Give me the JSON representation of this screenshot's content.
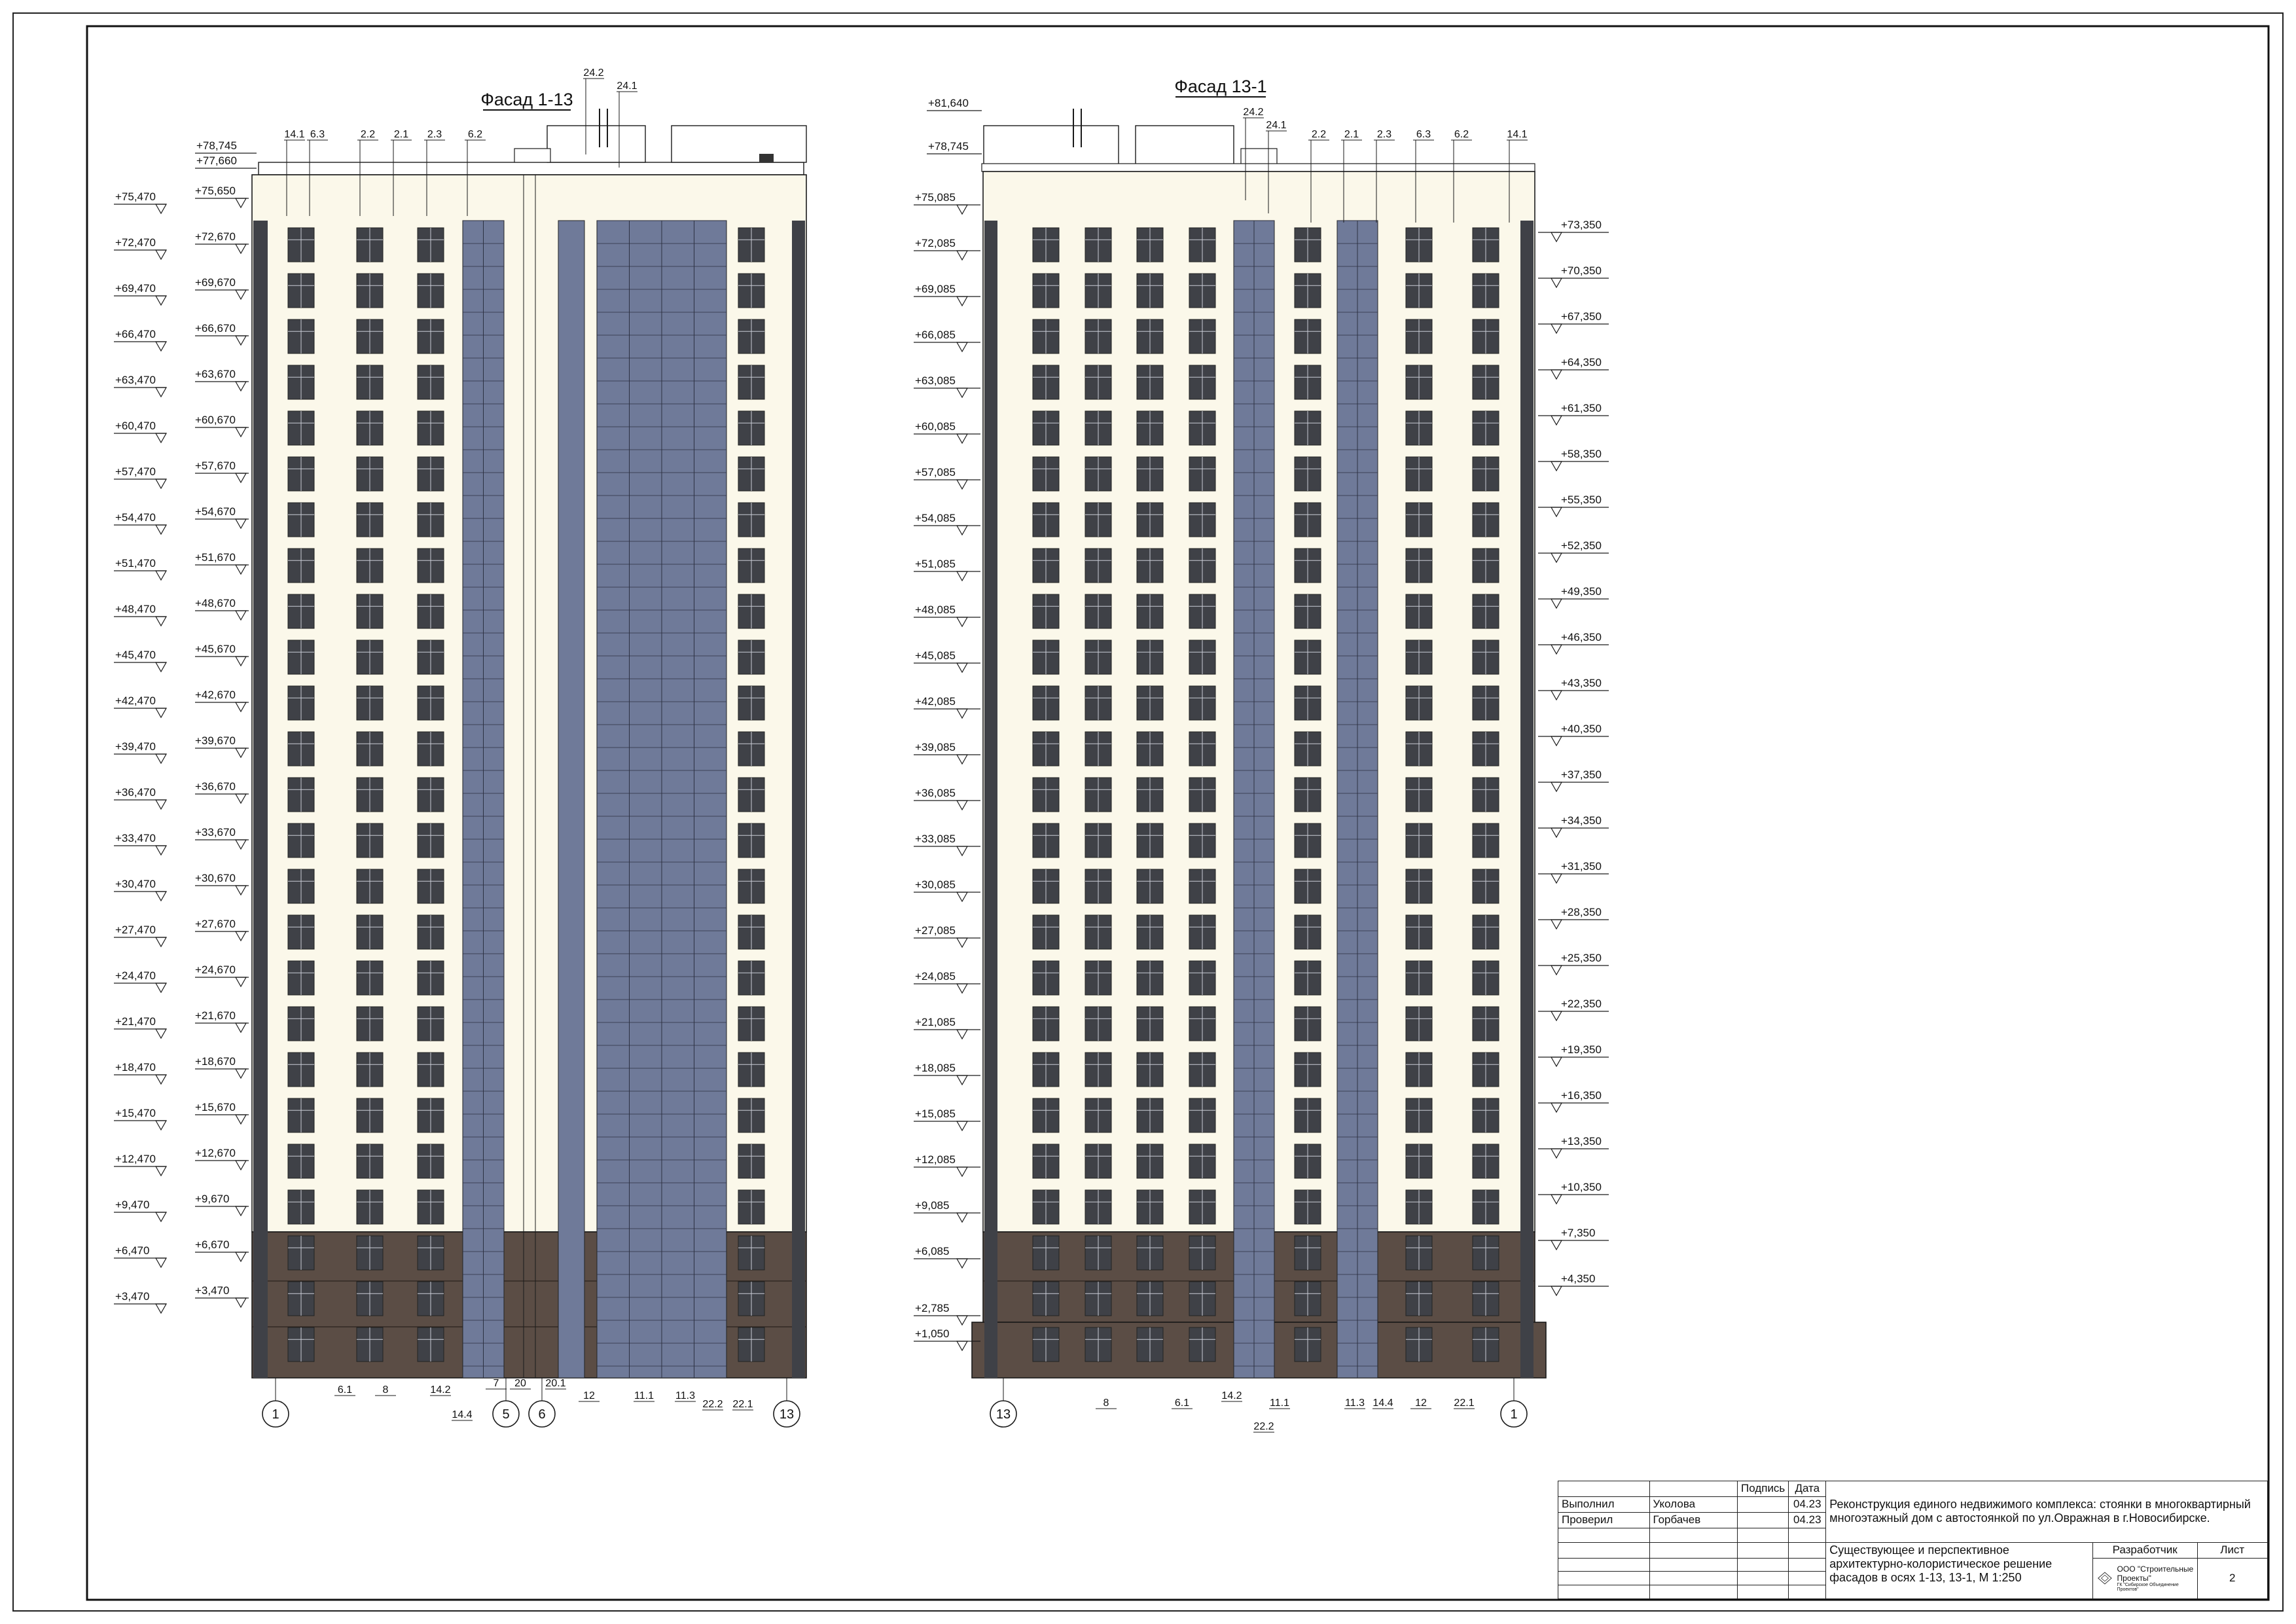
{
  "facade_left": {
    "title": "Фасад 1-13",
    "roof_marks": [
      "+78,745",
      "+77,660"
    ],
    "left_levels": [
      "+75,470",
      "+72,470",
      "+69,470",
      "+66,470",
      "+63,470",
      "+60,470",
      "+57,470",
      "+54,470",
      "+51,470",
      "+48,470",
      "+45,470",
      "+42,470",
      "+39,470",
      "+36,470",
      "+33,470",
      "+30,470",
      "+27,470",
      "+24,470",
      "+21,470",
      "+18,470",
      "+15,470",
      "+12,470",
      "+9,470",
      "+6,470",
      "+3,470"
    ],
    "right_levels": [
      "+75,650",
      "+72,670",
      "+69,670",
      "+66,670",
      "+63,670",
      "+60,670",
      "+57,670",
      "+54,670",
      "+51,670",
      "+48,670",
      "+45,670",
      "+42,670",
      "+39,670",
      "+36,670",
      "+33,670",
      "+30,670",
      "+27,670",
      "+24,670",
      "+21,670",
      "+18,670",
      "+15,670",
      "+12,670",
      "+9,670",
      "+6,670",
      "+3,470"
    ],
    "top_callouts": [
      "14.1",
      "6.3",
      "2.2",
      "2.1",
      "2.3",
      "6.2",
      "24.2",
      "24.1"
    ],
    "bottom_callouts": [
      "6.1",
      "8",
      "14.2",
      "14.4",
      "7",
      "20",
      "20.1",
      "12",
      "11.1",
      "11.3",
      "22.2",
      "22.1"
    ],
    "axes": [
      "1",
      "5",
      "6",
      "13"
    ]
  },
  "facade_right": {
    "title": "Фасад 13-1",
    "roof_marks": [
      "+81,640",
      "+78,745"
    ],
    "left_levels": [
      "+75,085",
      "+72,085",
      "+69,085",
      "+66,085",
      "+63,085",
      "+60,085",
      "+57,085",
      "+54,085",
      "+51,085",
      "+48,085",
      "+45,085",
      "+42,085",
      "+39,085",
      "+36,085",
      "+33,085",
      "+30,085",
      "+27,085",
      "+24,085",
      "+21,085",
      "+18,085",
      "+15,085",
      "+12,085",
      "+9,085",
      "+6,085",
      "+2,785",
      "+1,050"
    ],
    "right_levels": [
      "+73,350",
      "+70,350",
      "+67,350",
      "+64,350",
      "+61,350",
      "+58,350",
      "+55,350",
      "+52,350",
      "+49,350",
      "+46,350",
      "+43,350",
      "+40,350",
      "+37,350",
      "+34,350",
      "+31,350",
      "+28,350",
      "+25,350",
      "+22,350",
      "+19,350",
      "+16,350",
      "+13,350",
      "+10,350",
      "+7,350",
      "+4,350"
    ],
    "top_callouts": [
      "24.2",
      "24.1",
      "2.2",
      "2.1",
      "2.3",
      "6.3",
      "6.2",
      "14.1"
    ],
    "bottom_callouts": [
      "8",
      "6.1",
      "14.2",
      "22.2",
      "11.1",
      "11.3",
      "14.4",
      "12",
      "22.1"
    ],
    "axes": [
      "13",
      "1"
    ]
  },
  "title_block": {
    "col_signature": "Подпись",
    "col_date": "Дата",
    "row1_role": "Выполнил",
    "row1_name": "Уколова",
    "row1_date": "04.23",
    "row2_role": "Проверил",
    "row2_name": "Горбачев",
    "row2_date": "04.23",
    "project": "Реконструкция единого недвижимого комплекса: стоянки в многоквартирный многоэтажный дом с автостоянкой по ул.Овражная в г.Новосибирске.",
    "description": "Существующее и перспективное архитектурно-колористическое решение фасадов в осях 1-13, 13-1, М 1:250",
    "developer_label": "Разработчик",
    "sheet_label": "Лист",
    "sheet_number": "2",
    "company": "ООО \"Строительные Проекты\"",
    "company_sub": "ГК \"Сибирское Объединение Проектов\""
  },
  "colors": {
    "wall": "#fbf8ea",
    "base": "#5b4d45",
    "glass": "#6f7a99",
    "window_dark": "#3f4147",
    "line": "#1a1a1a"
  }
}
